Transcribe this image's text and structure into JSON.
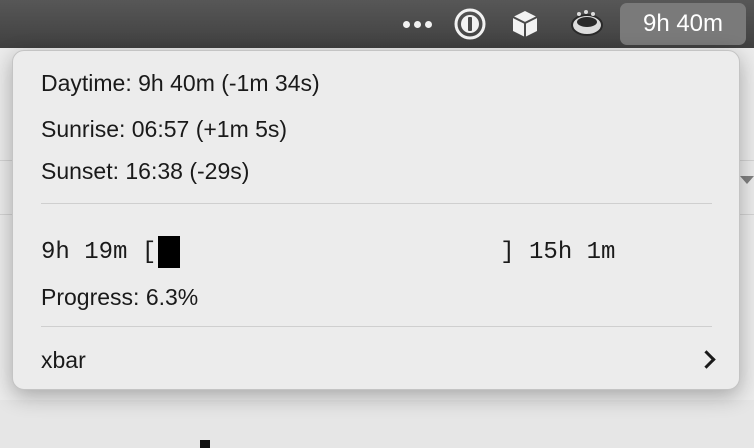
{
  "menubar": {
    "clock_text": "9h 40m",
    "icons": [
      "more-dots-icon",
      "onepassword-icon",
      "box-icon",
      "app-icon"
    ]
  },
  "menu": {
    "daytime": "Daytime: 9h 40m (-1m 34s)",
    "sunrise": "Sunrise: 06:57 (+1m 5s)",
    "sunset": "Sunset: 16:38 (-29s)",
    "progress_bar": {
      "left_label": "9h 19m [",
      "right_label": "] 15h 1m",
      "fill_fraction": 0.063
    },
    "progress_text": "Progress: 6.3%",
    "xbar_label": "xbar"
  }
}
